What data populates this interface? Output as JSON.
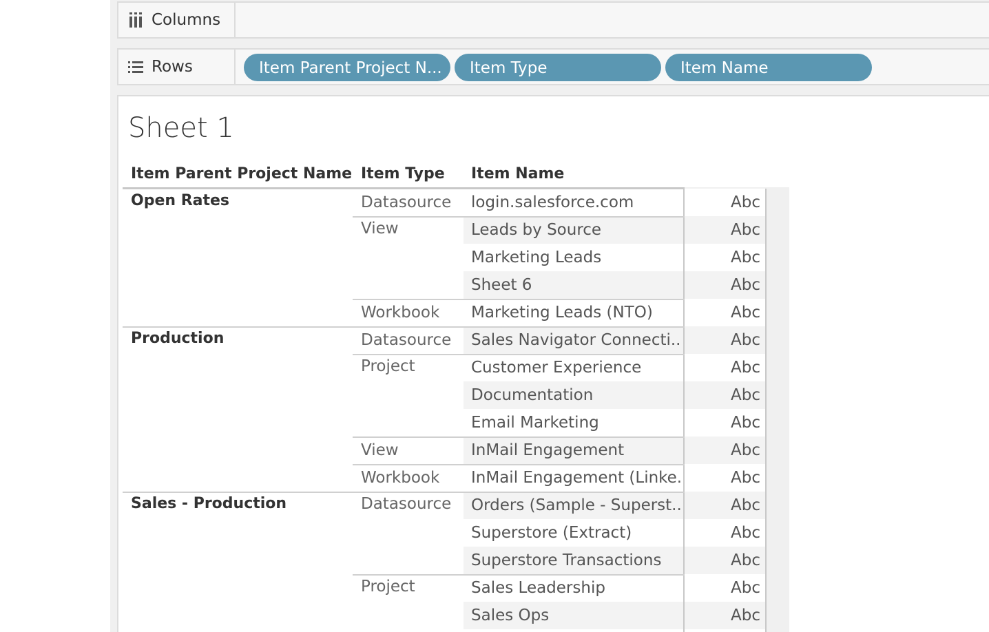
{
  "shelves": {
    "columns": {
      "label": "Columns",
      "icon": "columns-icon"
    },
    "rows": {
      "label": "Rows",
      "icon": "rows-icon",
      "pills": [
        "Item Parent Project N...",
        "Item Type",
        "Item Name"
      ]
    }
  },
  "sheet": {
    "title": "Sheet 1",
    "headers": [
      "Item Parent Project Name",
      "Item Type",
      "Item Name"
    ],
    "mark_label": "Abc"
  },
  "projects": [
    "Open Rates",
    "Production",
    "Sales - Production"
  ],
  "types": [
    "Datasource",
    "View",
    "Workbook",
    "Datasource",
    "Project",
    "View",
    "Workbook",
    "Datasource",
    "Project"
  ],
  "names": [
    "login.salesforce.com",
    "Leads by Source",
    "Marketing Leads",
    "Sheet 6",
    "Marketing Leads (NTO)",
    "Sales Navigator Connecti..",
    "Customer Experience",
    "Documentation",
    "Email Marketing",
    "InMail Engagement",
    "InMail Engagement (Linke..",
    "Orders (Sample - Superst..",
    "Superstore (Extract)",
    "Superstore Transactions",
    "Sales Leadership",
    "Sales Ops"
  ],
  "colors": {
    "pill": "#5b97b2",
    "shelf_bg": "#f7f7f7",
    "band": "#f3f3f3"
  }
}
